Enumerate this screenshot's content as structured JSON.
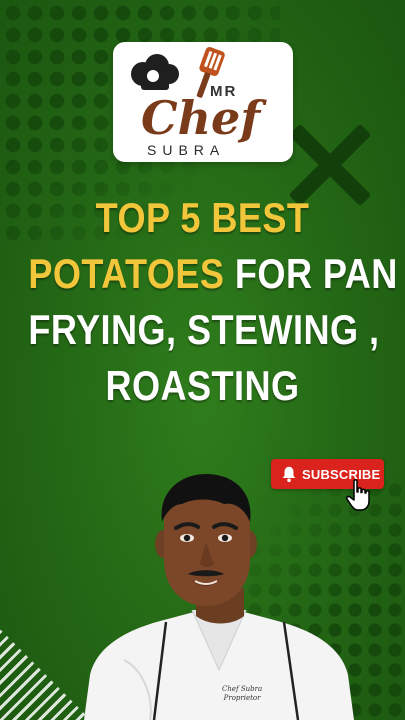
{
  "logo": {
    "brand_small": "MR",
    "brand_main": "Chef",
    "brand_sub": "SUBRA"
  },
  "headline": {
    "line1": "TOP 5 BEST",
    "line2_highlight": "POTATOES",
    "line2_rest": " FOR PAN",
    "line3": "FRYING, STEWING ,",
    "line4": "ROASTING"
  },
  "subscribe_button": {
    "label": "SUBSCRIBE",
    "icon": "bell-icon"
  },
  "coat_embroidery": {
    "name": "Chef Subra",
    "title": "Proprietor"
  },
  "colors": {
    "background": "#236615",
    "highlight_text": "#f2c63a",
    "subscribe_red": "#d9231c",
    "brand_brown": "#7a3b1a"
  }
}
